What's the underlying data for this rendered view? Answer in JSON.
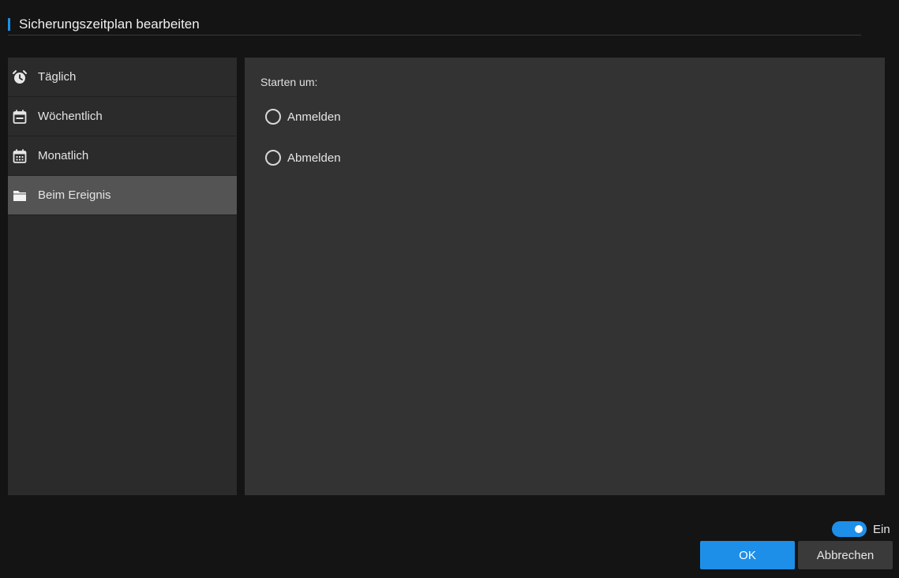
{
  "dialog": {
    "title": "Sicherungszeitplan bearbeiten",
    "accent_color": "#1e8fe8"
  },
  "sidebar": {
    "items": [
      {
        "label": "Täglich",
        "icon": "alarm-clock-icon",
        "active": false
      },
      {
        "label": "Wöchentlich",
        "icon": "calendar-week-icon",
        "active": false
      },
      {
        "label": "Monatlich",
        "icon": "calendar-month-icon",
        "active": false
      },
      {
        "label": "Beim Ereignis",
        "icon": "folder-icon",
        "active": true
      }
    ]
  },
  "main": {
    "start_label": "Starten um:",
    "options": [
      {
        "label": "Anmelden",
        "selected": false
      },
      {
        "label": "Abmelden",
        "selected": false
      }
    ]
  },
  "footer": {
    "toggle": {
      "label": "Ein",
      "on": true
    },
    "ok_label": "OK",
    "cancel_label": "Abbrechen"
  }
}
